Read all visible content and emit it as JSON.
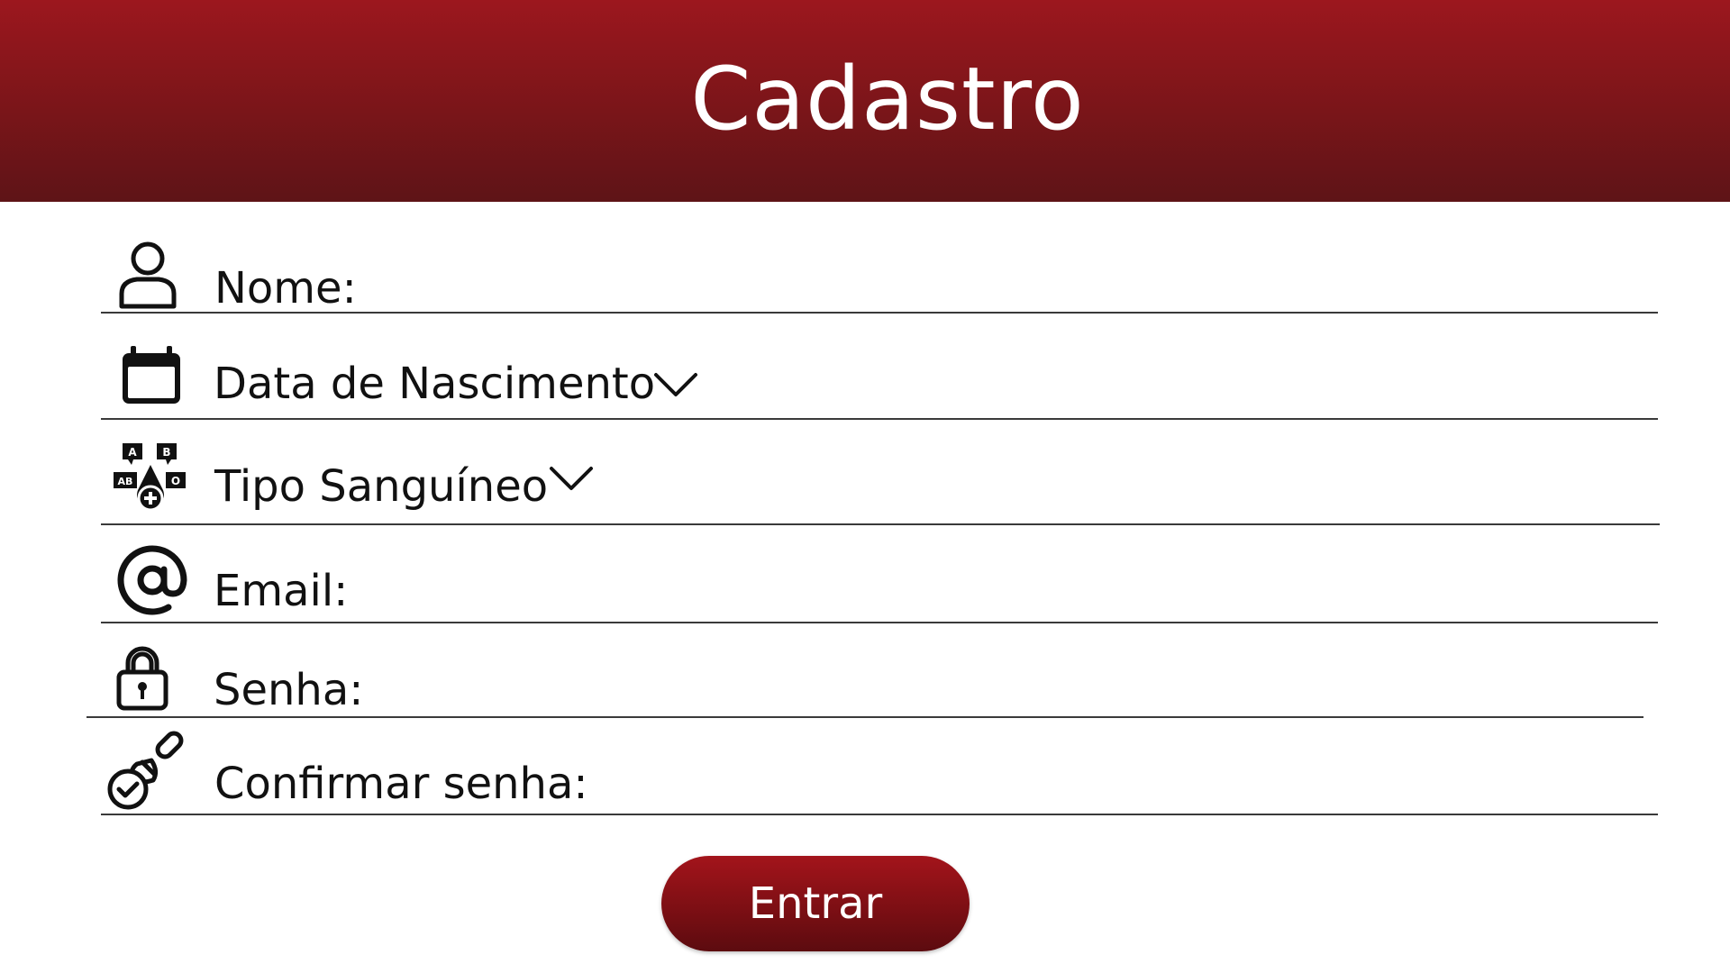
{
  "header": {
    "title": "Cadastro"
  },
  "form": {
    "fields": [
      {
        "label": "Nome:",
        "icon": "user-icon"
      },
      {
        "label": "Data de Nascimento",
        "icon": "calendar-icon",
        "dropdown": true
      },
      {
        "label": "Tipo Sanguíneo",
        "icon": "blood-type-icon",
        "dropdown": true
      },
      {
        "label": "Email:",
        "icon": "at-sign-icon"
      },
      {
        "label": "Senha:",
        "icon": "padlock-icon"
      },
      {
        "label": "Confirmar senha:",
        "icon": "stamp-check-icon"
      }
    ],
    "submit_label": "Entrar"
  },
  "colors": {
    "header_top": "#9c171e",
    "header_bottom": "#5e1417",
    "button": "#8a1117",
    "text": "#111111",
    "line": "#3a3a3a"
  }
}
